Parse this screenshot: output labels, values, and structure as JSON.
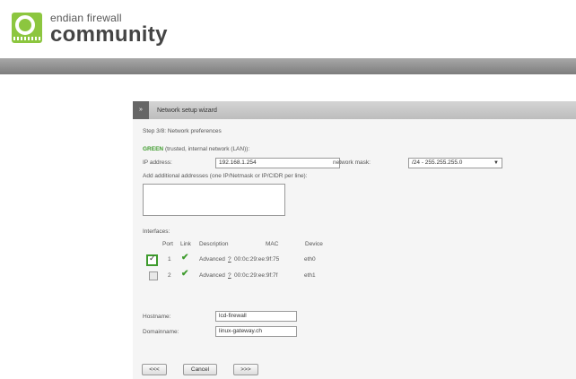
{
  "logo": {
    "line1": "endian firewall",
    "line2": "community"
  },
  "wizard": {
    "icon_text": "»",
    "title": "Network setup wizard",
    "step": "Step 3/8: Network preferences",
    "zone_name": "GREEN",
    "zone_desc": "(trusted, internal network (LAN)):",
    "ip_label": "IP address:",
    "ip_value": "192.168.1.254",
    "mask_label": "network mask:",
    "mask_value": "/24 - 255.255.255.0",
    "add_addresses_label": "Add additional addresses (one IP/Netmask or IP/CIDR per line):",
    "interfaces_label": "Interfaces:",
    "columns": [
      "Port",
      "Link",
      "Description",
      "MAC",
      "Device"
    ],
    "interfaces": [
      {
        "checked": true,
        "port": "1",
        "description": "Advanced",
        "help": "?",
        "mac": "00:0c:29:ee:9f:75",
        "device": "eth0"
      },
      {
        "checked": false,
        "port": "2",
        "description": "Advanced",
        "help": "?",
        "mac": "00:0c:29:ee:9f:7f",
        "device": "eth1"
      }
    ],
    "hostname_label": "Hostname:",
    "hostname_value": "lcd-firewall",
    "domain_label": "Domainname:",
    "domain_value": "linux-gateway.ch",
    "buttons": {
      "prev": "<<<",
      "cancel": "Cancel",
      "next": ">>>"
    }
  }
}
